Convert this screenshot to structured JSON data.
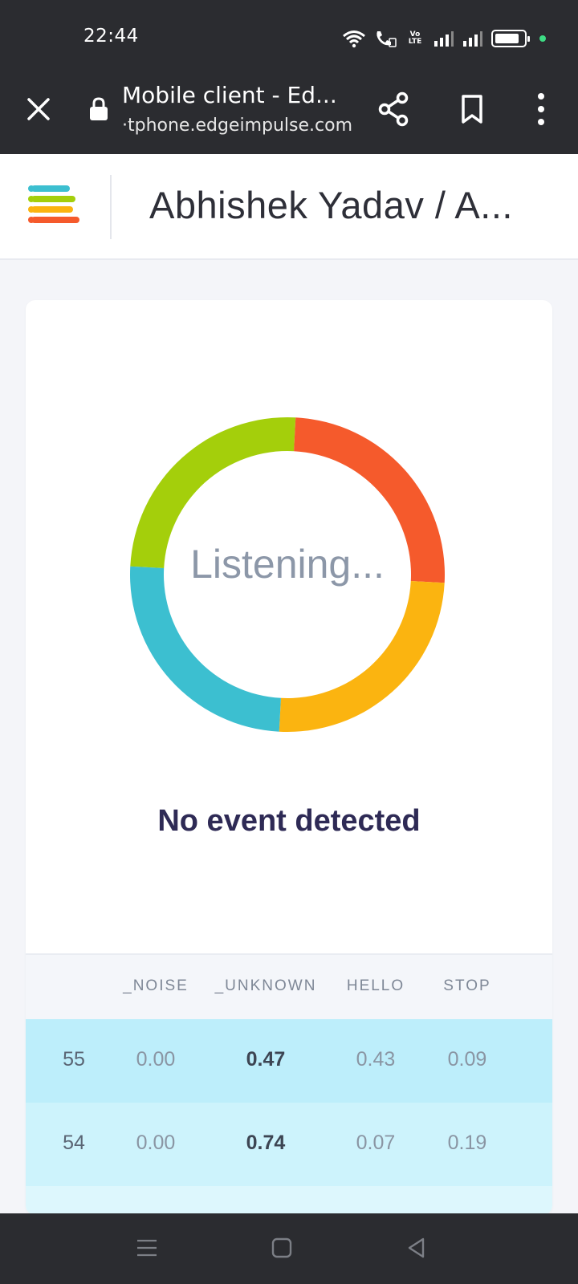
{
  "status_bar": {
    "time": "22:44",
    "volte_label": "Vo LTE",
    "icons": [
      "wifi-icon",
      "wifi-calling-icon",
      "volte-icon",
      "signal-icon",
      "signal-icon",
      "battery-icon"
    ],
    "battery_level": 0.85
  },
  "browser": {
    "page_title": "Mobile client - Ed...",
    "url": "·tphone.edgeimpulse.com",
    "icons": [
      "close-icon",
      "lock-icon",
      "share-icon",
      "bookmark-icon",
      "more-vert-icon"
    ]
  },
  "app": {
    "project_title": "Abhishek Yadav / A...",
    "logo_colors": [
      "#3cbfd0",
      "#a4cf0b",
      "#fbb410",
      "#f55a2c"
    ]
  },
  "classifier": {
    "listening_text": "Listening...",
    "event_status": "No event detected",
    "ring_colors": [
      "#a4cf0b",
      "#f55a2c",
      "#fbb410",
      "#3cbfd0"
    ]
  },
  "table": {
    "columns": [
      "",
      "_NOISE",
      "_UNKNOWN",
      "HELLO",
      "STOP"
    ],
    "rows": [
      {
        "index": "55",
        "values": [
          "0.00",
          "0.47",
          "0.43",
          "0.09"
        ],
        "top_col": 1
      },
      {
        "index": "54",
        "values": [
          "0.00",
          "0.74",
          "0.07",
          "0.19"
        ],
        "top_col": 1
      }
    ]
  },
  "nav": {
    "icons": [
      "recent-apps-icon",
      "home-icon",
      "back-icon"
    ]
  }
}
